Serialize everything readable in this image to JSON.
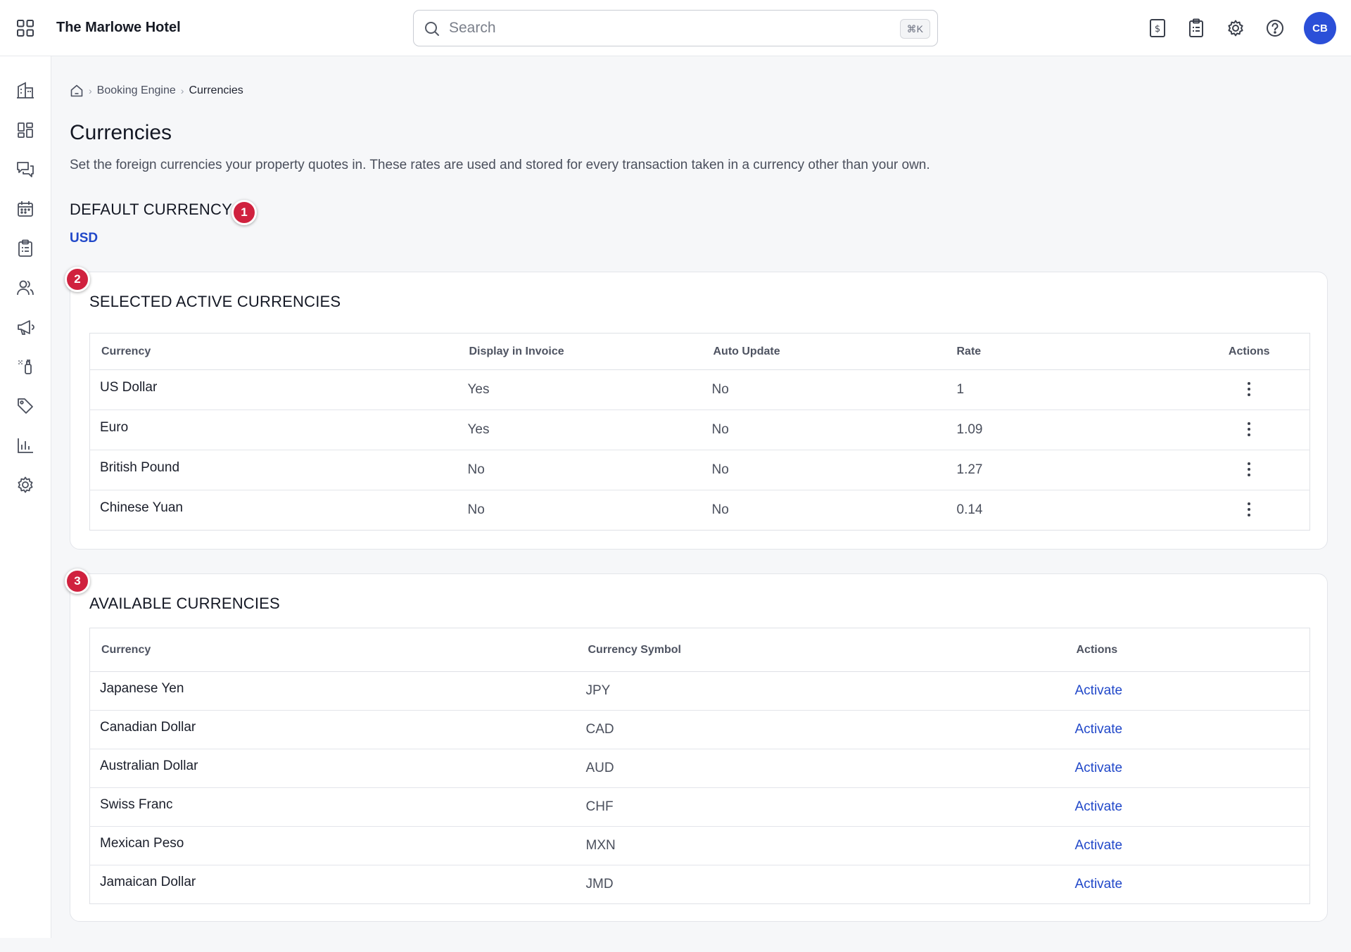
{
  "header": {
    "hotel_name": "The Marlowe Hotel",
    "search_placeholder": "Search",
    "search_shortcut": "⌘K",
    "avatar_initials": "CB",
    "icons": [
      "apps-grid-icon",
      "billing-icon",
      "clipboard-icon",
      "gear-icon",
      "help-icon"
    ]
  },
  "sidebar": {
    "items": [
      "building-icon",
      "dashboard-icon",
      "messages-icon",
      "calendar-icon",
      "clipboard-icon",
      "guests-icon",
      "megaphone-icon",
      "housekeeping-icon",
      "tag-icon",
      "reports-icon",
      "settings-icon"
    ]
  },
  "breadcrumb": {
    "items": [
      "Booking Engine",
      "Currencies"
    ]
  },
  "page": {
    "title": "Currencies",
    "description": "Set the foreign currencies your property quotes in. These rates are used and stored for every transaction taken in a currency other than your own."
  },
  "default_currency": {
    "label": "DEFAULT CURRENCY",
    "value": "USD",
    "marker": "1"
  },
  "selected": {
    "title": "SELECTED ACTIVE CURRENCIES",
    "marker": "2",
    "columns": [
      "Currency",
      "Display in Invoice",
      "Auto Update",
      "Rate",
      "Actions"
    ],
    "rows": [
      {
        "currency": "US Dollar",
        "display": "Yes",
        "auto": "No",
        "rate": "1"
      },
      {
        "currency": "Euro",
        "display": "Yes",
        "auto": "No",
        "rate": "1.09"
      },
      {
        "currency": "British Pound",
        "display": "No",
        "auto": "No",
        "rate": "1.27"
      },
      {
        "currency": "Chinese Yuan",
        "display": "No",
        "auto": "No",
        "rate": "0.14"
      }
    ]
  },
  "available": {
    "title": "AVAILABLE CURRENCIES",
    "marker": "3",
    "columns": [
      "Currency",
      "Currency Symbol",
      "Actions"
    ],
    "action_label": "Activate",
    "rows": [
      {
        "currency": "Japanese Yen",
        "symbol": "JPY"
      },
      {
        "currency": "Canadian Dollar",
        "symbol": "CAD"
      },
      {
        "currency": "Australian Dollar",
        "symbol": "AUD"
      },
      {
        "currency": "Swiss Franc",
        "symbol": "CHF"
      },
      {
        "currency": "Mexican Peso",
        "symbol": "MXN"
      },
      {
        "currency": "Jamaican Dollar",
        "symbol": "JMD"
      }
    ]
  },
  "colors": {
    "accent": "#2148c9",
    "marker": "#d0213e",
    "avatar": "#2b4fd8"
  }
}
